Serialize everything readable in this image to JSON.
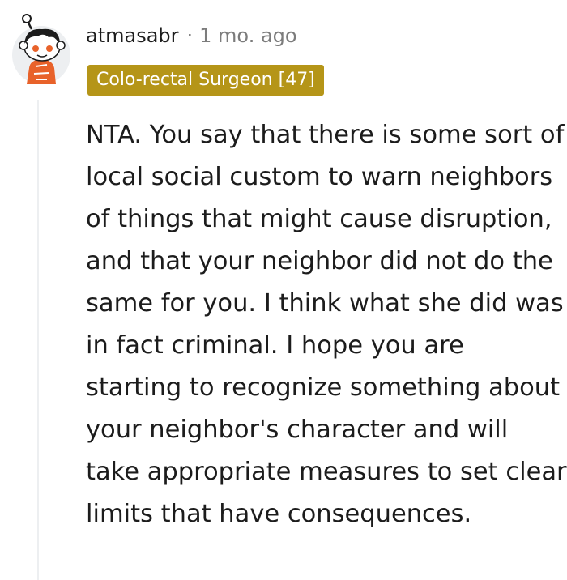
{
  "comment": {
    "username": "atmasabr",
    "separator": "·",
    "time": "1 mo. ago",
    "flair": "Colo-rectal Surgeon [47]",
    "body": "NTA. You say that there is some sort of local social custom to warn neighbors of things that might cause disruption, and that your neighbor did not do the same for you. I think what she did was in fact criminal. I hope you are starting to recognize something about your neighbor's character and will take appropriate measures to set clear limits that have consequences."
  },
  "colors": {
    "flair_background": "#b59518",
    "avatar_orange": "#e8622a",
    "text": "#1c1c1c",
    "muted": "#7c7c7c"
  },
  "icons": {
    "avatar": "snoo-avatar-icon"
  }
}
